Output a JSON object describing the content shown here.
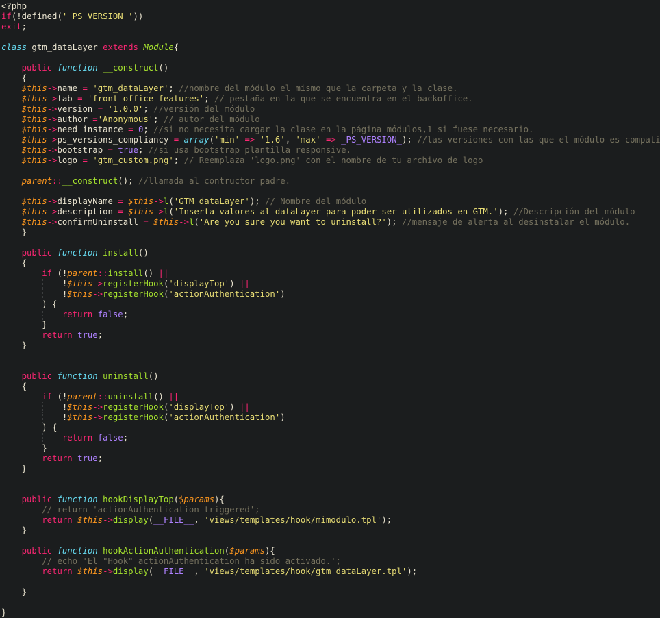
{
  "editor": {
    "language": "php",
    "theme": {
      "background": "#1b1d1e",
      "plain": "#e9e3cf",
      "keyword": "#f92672",
      "string": "#e6db74",
      "comment": "#75715e",
      "number": "#ae81ff",
      "function": "#a6e22e",
      "type": "#66d9ef",
      "variable": "#fd971f"
    },
    "lines": [
      [
        [
          "p",
          "<?php"
        ]
      ],
      [
        [
          "kw",
          "if"
        ],
        [
          "p",
          "(!defined("
        ],
        [
          "st",
          "'_PS_VERSION_'"
        ],
        [
          "p",
          "))"
        ]
      ],
      [
        [
          "kw",
          "exit"
        ],
        [
          "p",
          ";"
        ]
      ],
      [],
      [
        [
          "ty",
          "class"
        ],
        [
          "p",
          " gtm_dataLayer "
        ],
        [
          "kw",
          "extends"
        ],
        [
          "p",
          " "
        ],
        [
          "cl",
          "Module"
        ],
        [
          "p",
          "{"
        ]
      ],
      [],
      [
        [
          "p",
          "    "
        ],
        [
          "kw",
          "public"
        ],
        [
          "p",
          " "
        ],
        [
          "ty",
          "function"
        ],
        [
          "p",
          " "
        ],
        [
          "fn",
          "__construct"
        ],
        [
          "p",
          "()"
        ]
      ],
      [
        [
          "p",
          "    {"
        ]
      ],
      [
        [
          "p",
          "    "
        ],
        [
          "var",
          "$this"
        ],
        [
          "kw",
          "->"
        ],
        [
          "p",
          "name "
        ],
        [
          "kw",
          "="
        ],
        [
          "p",
          " "
        ],
        [
          "st",
          "'gtm_dataLayer'"
        ],
        [
          "p",
          "; "
        ],
        [
          "cm",
          "//nombre del módulo el mismo que la carpeta y la clase."
        ]
      ],
      [
        [
          "p",
          "    "
        ],
        [
          "var",
          "$this"
        ],
        [
          "kw",
          "->"
        ],
        [
          "p",
          "tab "
        ],
        [
          "kw",
          "="
        ],
        [
          "p",
          " "
        ],
        [
          "st",
          "'front_office_features'"
        ],
        [
          "p",
          "; "
        ],
        [
          "cm",
          "// pestaña en la que se encuentra en el backoffice."
        ]
      ],
      [
        [
          "p",
          "    "
        ],
        [
          "var",
          "$this"
        ],
        [
          "kw",
          "->"
        ],
        [
          "p",
          "version "
        ],
        [
          "kw",
          "="
        ],
        [
          "p",
          " "
        ],
        [
          "st",
          "'1.0.0'"
        ],
        [
          "p",
          "; "
        ],
        [
          "cm",
          "//versión del módulo"
        ]
      ],
      [
        [
          "p",
          "    "
        ],
        [
          "var",
          "$this"
        ],
        [
          "kw",
          "->"
        ],
        [
          "p",
          "author "
        ],
        [
          "kw",
          "="
        ],
        [
          "st",
          "'Anonymous'"
        ],
        [
          "p",
          "; "
        ],
        [
          "cm",
          "// autor del módulo"
        ]
      ],
      [
        [
          "p",
          "    "
        ],
        [
          "var",
          "$this"
        ],
        [
          "kw",
          "->"
        ],
        [
          "p",
          "need_instance "
        ],
        [
          "kw",
          "="
        ],
        [
          "p",
          " "
        ],
        [
          "nm",
          "0"
        ],
        [
          "p",
          "; "
        ],
        [
          "cm",
          "//si no necesita cargar la clase en la página módulos,1 si fuese necesario."
        ]
      ],
      [
        [
          "p",
          "    "
        ],
        [
          "var",
          "$this"
        ],
        [
          "kw",
          "->"
        ],
        [
          "p",
          "ps_versions_compliancy "
        ],
        [
          "kw",
          "="
        ],
        [
          "p",
          " "
        ],
        [
          "ty",
          "array"
        ],
        [
          "p",
          "("
        ],
        [
          "st",
          "'min'"
        ],
        [
          "p",
          " "
        ],
        [
          "kw",
          "=>"
        ],
        [
          "p",
          " "
        ],
        [
          "st",
          "'1.6'"
        ],
        [
          "p",
          ", "
        ],
        [
          "st",
          "'max'"
        ],
        [
          "p",
          " "
        ],
        [
          "kw",
          "=>"
        ],
        [
          "p",
          " "
        ],
        [
          "nm",
          "_PS_VERSION_"
        ],
        [
          "p",
          "); "
        ],
        [
          "cm",
          "//las versiones con las que el módulo es compatible."
        ]
      ],
      [
        [
          "p",
          "    "
        ],
        [
          "var",
          "$this"
        ],
        [
          "kw",
          "->"
        ],
        [
          "p",
          "bootstrap "
        ],
        [
          "kw",
          "="
        ],
        [
          "p",
          " "
        ],
        [
          "nm",
          "true"
        ],
        [
          "p",
          "; "
        ],
        [
          "cm",
          "//si usa bootstrap plantilla responsive."
        ]
      ],
      [
        [
          "p",
          "    "
        ],
        [
          "var",
          "$this"
        ],
        [
          "kw",
          "->"
        ],
        [
          "p",
          "logo "
        ],
        [
          "kw",
          "="
        ],
        [
          "p",
          " "
        ],
        [
          "st",
          "'gtm_custom.png'"
        ],
        [
          "p",
          "; "
        ],
        [
          "cm",
          "// Reemplaza 'logo.png' con el nombre de tu archivo de logo"
        ]
      ],
      [],
      [
        [
          "p",
          "    "
        ],
        [
          "var",
          "parent"
        ],
        [
          "kw",
          "::"
        ],
        [
          "fn",
          "__construct"
        ],
        [
          "p",
          "(); "
        ],
        [
          "cm",
          "//llamada al contructor padre."
        ]
      ],
      [],
      [
        [
          "p",
          "    "
        ],
        [
          "var",
          "$this"
        ],
        [
          "kw",
          "->"
        ],
        [
          "p",
          "displayName "
        ],
        [
          "kw",
          "="
        ],
        [
          "p",
          " "
        ],
        [
          "var",
          "$this"
        ],
        [
          "kw",
          "->"
        ],
        [
          "fn",
          "l"
        ],
        [
          "p",
          "("
        ],
        [
          "st",
          "'GTM dataLayer'"
        ],
        [
          "p",
          "); "
        ],
        [
          "cm",
          "// Nombre del módulo"
        ]
      ],
      [
        [
          "p",
          "    "
        ],
        [
          "var",
          "$this"
        ],
        [
          "kw",
          "->"
        ],
        [
          "p",
          "description "
        ],
        [
          "kw",
          "="
        ],
        [
          "p",
          " "
        ],
        [
          "var",
          "$this"
        ],
        [
          "kw",
          "->"
        ],
        [
          "fn",
          "l"
        ],
        [
          "p",
          "("
        ],
        [
          "st",
          "'Inserta valores al dataLayer para poder ser utilizados en GTM.'"
        ],
        [
          "p",
          "); "
        ],
        [
          "cm",
          "//Descripción del módulo"
        ]
      ],
      [
        [
          "p",
          "    "
        ],
        [
          "var",
          "$this"
        ],
        [
          "kw",
          "->"
        ],
        [
          "p",
          "confirmUninstall "
        ],
        [
          "kw",
          "="
        ],
        [
          "p",
          " "
        ],
        [
          "var",
          "$this"
        ],
        [
          "kw",
          "->"
        ],
        [
          "fn",
          "l"
        ],
        [
          "p",
          "("
        ],
        [
          "st",
          "'Are you sure you want to uninstall?'"
        ],
        [
          "p",
          "); "
        ],
        [
          "cm",
          "//mensaje de alerta al desinstalar el módulo."
        ]
      ],
      [
        [
          "p",
          "    }"
        ]
      ],
      [],
      [
        [
          "p",
          "    "
        ],
        [
          "kw",
          "public"
        ],
        [
          "p",
          " "
        ],
        [
          "ty",
          "function"
        ],
        [
          "p",
          " "
        ],
        [
          "fn",
          "install"
        ],
        [
          "p",
          "()"
        ]
      ],
      [
        [
          "p",
          "    {"
        ]
      ],
      [
        [
          "p",
          "        "
        ],
        [
          "kw",
          "if"
        ],
        [
          "p",
          " (!"
        ],
        [
          "var",
          "parent"
        ],
        [
          "kw",
          "::"
        ],
        [
          "fn",
          "install"
        ],
        [
          "p",
          "() "
        ],
        [
          "kw",
          "||"
        ]
      ],
      [
        [
          "p",
          "            !"
        ],
        [
          "var",
          "$this"
        ],
        [
          "kw",
          "->"
        ],
        [
          "fn",
          "registerHook"
        ],
        [
          "p",
          "("
        ],
        [
          "st",
          "'displayTop'"
        ],
        [
          "p",
          ") "
        ],
        [
          "kw",
          "||"
        ]
      ],
      [
        [
          "p",
          "            !"
        ],
        [
          "var",
          "$this"
        ],
        [
          "kw",
          "->"
        ],
        [
          "fn",
          "registerHook"
        ],
        [
          "p",
          "("
        ],
        [
          "st",
          "'actionAuthentication'"
        ],
        [
          "p",
          ")"
        ]
      ],
      [
        [
          "p",
          "        ) {"
        ]
      ],
      [
        [
          "p",
          "            "
        ],
        [
          "kw",
          "return"
        ],
        [
          "p",
          " "
        ],
        [
          "nm",
          "false"
        ],
        [
          "p",
          ";"
        ]
      ],
      [
        [
          "p",
          "        }"
        ]
      ],
      [
        [
          "p",
          "        "
        ],
        [
          "kw",
          "return"
        ],
        [
          "p",
          " "
        ],
        [
          "nm",
          "true"
        ],
        [
          "p",
          ";"
        ]
      ],
      [
        [
          "p",
          "    }"
        ]
      ],
      [],
      [],
      [
        [
          "p",
          "    "
        ],
        [
          "kw",
          "public"
        ],
        [
          "p",
          " "
        ],
        [
          "ty",
          "function"
        ],
        [
          "p",
          " "
        ],
        [
          "fn",
          "uninstall"
        ],
        [
          "p",
          "()"
        ]
      ],
      [
        [
          "p",
          "    {"
        ]
      ],
      [
        [
          "p",
          "        "
        ],
        [
          "kw",
          "if"
        ],
        [
          "p",
          " (!"
        ],
        [
          "var",
          "parent"
        ],
        [
          "kw",
          "::"
        ],
        [
          "fn",
          "uninstall"
        ],
        [
          "p",
          "() "
        ],
        [
          "kw",
          "||"
        ]
      ],
      [
        [
          "p",
          "            !"
        ],
        [
          "var",
          "$this"
        ],
        [
          "kw",
          "->"
        ],
        [
          "fn",
          "registerHook"
        ],
        [
          "p",
          "("
        ],
        [
          "st",
          "'displayTop'"
        ],
        [
          "p",
          ") "
        ],
        [
          "kw",
          "||"
        ]
      ],
      [
        [
          "p",
          "            !"
        ],
        [
          "var",
          "$this"
        ],
        [
          "kw",
          "->"
        ],
        [
          "fn",
          "registerHook"
        ],
        [
          "p",
          "("
        ],
        [
          "st",
          "'actionAuthentication'"
        ],
        [
          "p",
          ")"
        ]
      ],
      [
        [
          "p",
          "        ) {"
        ]
      ],
      [
        [
          "p",
          "            "
        ],
        [
          "kw",
          "return"
        ],
        [
          "p",
          " "
        ],
        [
          "nm",
          "false"
        ],
        [
          "p",
          ";"
        ]
      ],
      [
        [
          "p",
          "        }"
        ]
      ],
      [
        [
          "p",
          "        "
        ],
        [
          "kw",
          "return"
        ],
        [
          "p",
          " "
        ],
        [
          "nm",
          "true"
        ],
        [
          "p",
          ";"
        ]
      ],
      [
        [
          "p",
          "    }"
        ]
      ],
      [],
      [],
      [
        [
          "p",
          "    "
        ],
        [
          "kw",
          "public"
        ],
        [
          "p",
          " "
        ],
        [
          "ty",
          "function"
        ],
        [
          "p",
          " "
        ],
        [
          "fn",
          "hookDisplayTop"
        ],
        [
          "p",
          "("
        ],
        [
          "var",
          "$params"
        ],
        [
          "p",
          "){"
        ]
      ],
      [
        [
          "p",
          "        "
        ],
        [
          "cm",
          "// return 'actionAuthentication triggered';"
        ]
      ],
      [
        [
          "p",
          "        "
        ],
        [
          "kw",
          "return"
        ],
        [
          "p",
          " "
        ],
        [
          "var",
          "$this"
        ],
        [
          "kw",
          "->"
        ],
        [
          "fn",
          "display"
        ],
        [
          "p",
          "("
        ],
        [
          "nm",
          "__FILE__"
        ],
        [
          "p",
          ", "
        ],
        [
          "st",
          "'views/templates/hook/mimodulo.tpl'"
        ],
        [
          "p",
          ");"
        ]
      ],
      [
        [
          "p",
          "    }"
        ]
      ],
      [],
      [
        [
          "p",
          "    "
        ],
        [
          "kw",
          "public"
        ],
        [
          "p",
          " "
        ],
        [
          "ty",
          "function"
        ],
        [
          "p",
          " "
        ],
        [
          "fn",
          "hookActionAuthentication"
        ],
        [
          "p",
          "("
        ],
        [
          "var",
          "$params"
        ],
        [
          "p",
          "){"
        ]
      ],
      [
        [
          "p",
          "        "
        ],
        [
          "cm",
          "// echo 'El \"Hook\" actionAuthentication ha sido activado.';"
        ]
      ],
      [
        [
          "p",
          "        "
        ],
        [
          "kw",
          "return"
        ],
        [
          "p",
          " "
        ],
        [
          "var",
          "$this"
        ],
        [
          "kw",
          "->"
        ],
        [
          "fn",
          "display"
        ],
        [
          "p",
          "("
        ],
        [
          "nm",
          "__FILE__"
        ],
        [
          "p",
          ", "
        ],
        [
          "st",
          "'views/templates/hook/gtm_dataLayer.tpl'"
        ],
        [
          "p",
          ");"
        ]
      ],
      [],
      [
        [
          "p",
          "    }"
        ]
      ],
      [],
      [
        [
          "p",
          "}"
        ]
      ]
    ]
  }
}
